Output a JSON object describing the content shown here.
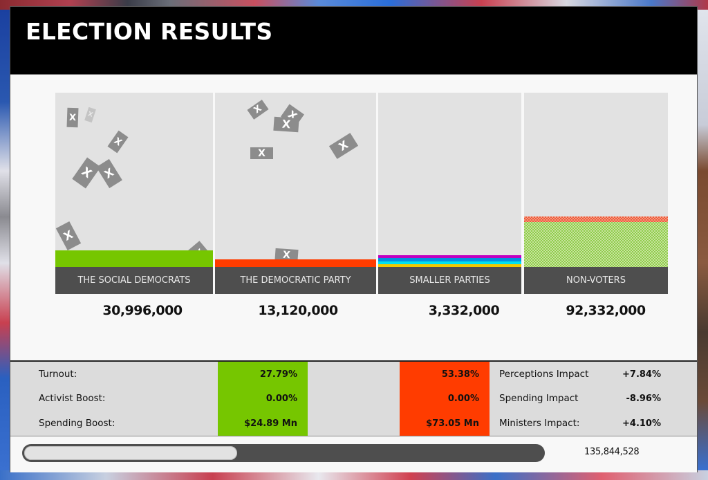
{
  "window": {
    "title": "ELECTION RESULTS"
  },
  "parties": [
    {
      "name": "THE SOCIAL DEMOCRATS",
      "total": "30,996,000",
      "color": "#76c600",
      "votes": 30996000
    },
    {
      "name": "THE DEMOCRATIC PARTY",
      "total": "13,120,000",
      "color": "#ff3c00",
      "votes": 13120000
    },
    {
      "name": "SMALLER PARTIES",
      "total": "3,332,000",
      "stripe_colors": [
        "#c000c0",
        "#0090e0",
        "#00e0f0",
        "#f0c800"
      ],
      "votes": 3332000
    },
    {
      "name": "NON-VOTERS",
      "total": "92,332,000",
      "votes": 92332000
    }
  ],
  "ballot_mark": "X",
  "stats": {
    "left_labels": [
      "Turnout:",
      "Activist Boost:",
      "Spending Boost:"
    ],
    "party1_values": [
      "27.79%",
      "0.00%",
      "$24.89 Mn"
    ],
    "party2_values": [
      "53.38%",
      "0.00%",
      "$73.05 Mn"
    ],
    "impacts": [
      {
        "label": "Perceptions Impact",
        "value": "+7.84%"
      },
      {
        "label": "Spending Impact",
        "value": "-8.96%"
      },
      {
        "label": "Ministers Impact:",
        "value": "+4.10%"
      }
    ],
    "party1_color": "#76c600",
    "party2_color": "#ff3c00"
  },
  "progress": {
    "fraction": 0.41,
    "count": "135,844,528"
  }
}
